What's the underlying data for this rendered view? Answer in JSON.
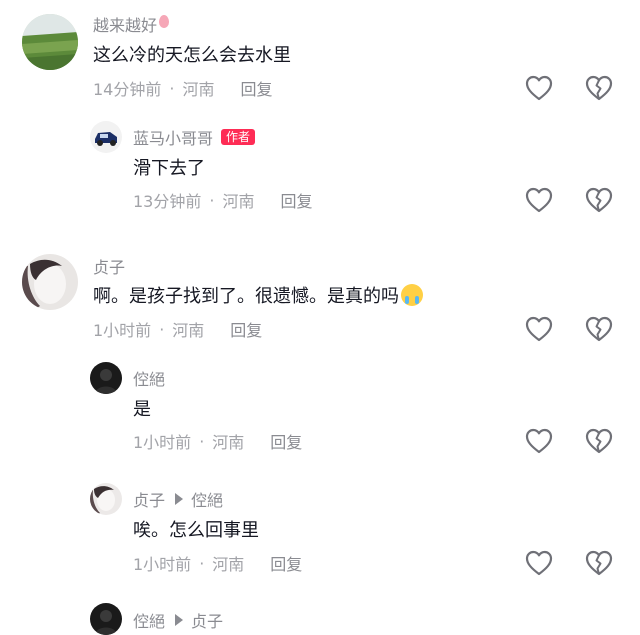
{
  "comments": [
    {
      "username": "越来越好",
      "text": "这么冷的天怎么会去水里",
      "time": "14分钟前",
      "location": "河南",
      "reply_label": "回复"
    },
    {
      "username": "蓝马小哥哥",
      "badge": "作者",
      "text": "滑下去了",
      "time": "13分钟前",
      "location": "河南",
      "reply_label": "回复"
    },
    {
      "username": "贞子",
      "text": "啊。是孩子找到了。很遗憾。是真的吗",
      "emoji": "crying-face",
      "time": "1小时前",
      "location": "河南",
      "reply_label": "回复"
    },
    {
      "username": "倥絕",
      "text": "是",
      "time": "1小时前",
      "location": "河南",
      "reply_label": "回复"
    },
    {
      "username": "贞子",
      "reply_to": "倥絕",
      "text": "唉。怎么回事里",
      "time": "1小时前",
      "location": "河南",
      "reply_label": "回复"
    },
    {
      "username": "倥絕",
      "reply_to": "贞子"
    }
  ],
  "colors": {
    "author_badge": "#fe2c55",
    "meta_text": "#a2a3a8",
    "name_text": "#8a8b91",
    "body_text": "#161823"
  },
  "icons": {
    "like": "heart-outline-icon",
    "dislike": "broken-heart-outline-icon"
  }
}
